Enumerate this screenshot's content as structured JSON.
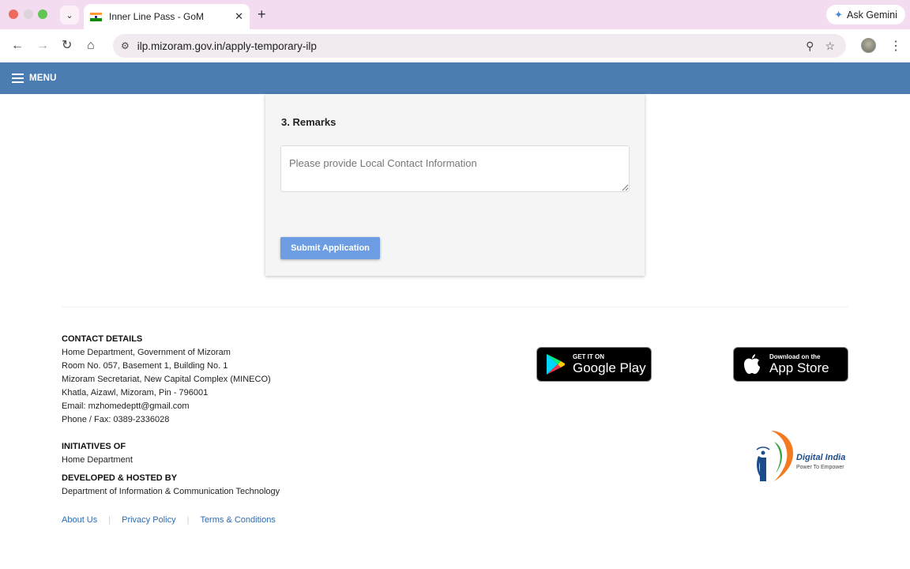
{
  "browser": {
    "tab_title": "Inner Line Pass - GoM",
    "url": "ilp.mizoram.gov.in/apply-temporary-ilp",
    "gemini_label": "Ask Gemini",
    "icons": [
      "back-icon",
      "forward-icon",
      "reload-icon",
      "home-icon",
      "site-info-icon",
      "zoom-icon",
      "bookmark-star-icon",
      "kebab-menu-icon"
    ]
  },
  "header": {
    "menu_label": "MENU"
  },
  "form": {
    "section_title": "3. Remarks",
    "remarks_placeholder": "Please provide Local Contact Information",
    "remarks_value": "",
    "submit_label": "Submit Application"
  },
  "footer": {
    "contact_heading": "CONTACT DETAILS",
    "contact_lines": [
      "Home Department, Government of Mizoram",
      "Room No. 057, Basement 1, Building No. 1",
      "Mizoram Secretariat, New Capital Complex (MINECO)",
      "Khatla, Aizawl, Mizoram, Pin - 796001",
      "Email: mzhomedeptt@gmail.com",
      "Phone / Fax: 0389-2336028"
    ],
    "initiatives_heading": "INITIATIVES OF",
    "initiatives_value": "Home Department",
    "developed_heading": "DEVELOPED & HOSTED BY",
    "developed_value": "Department of Information & Communication Technology",
    "links": [
      "About Us",
      "Privacy Policy",
      "Terms & Conditions"
    ],
    "google_play": {
      "small": "GET IT ON",
      "big": "Google Play"
    },
    "app_store": {
      "small": "Download on the",
      "big": "App Store"
    },
    "digital_india": {
      "title": "Digital India",
      "subtitle": "Power To Empower"
    }
  },
  "colors": {
    "menu_bar": "#4b7db3",
    "submit_button": "#6d9ee3",
    "link": "#2e6bb3",
    "tab_strip": "#f3dcef"
  }
}
